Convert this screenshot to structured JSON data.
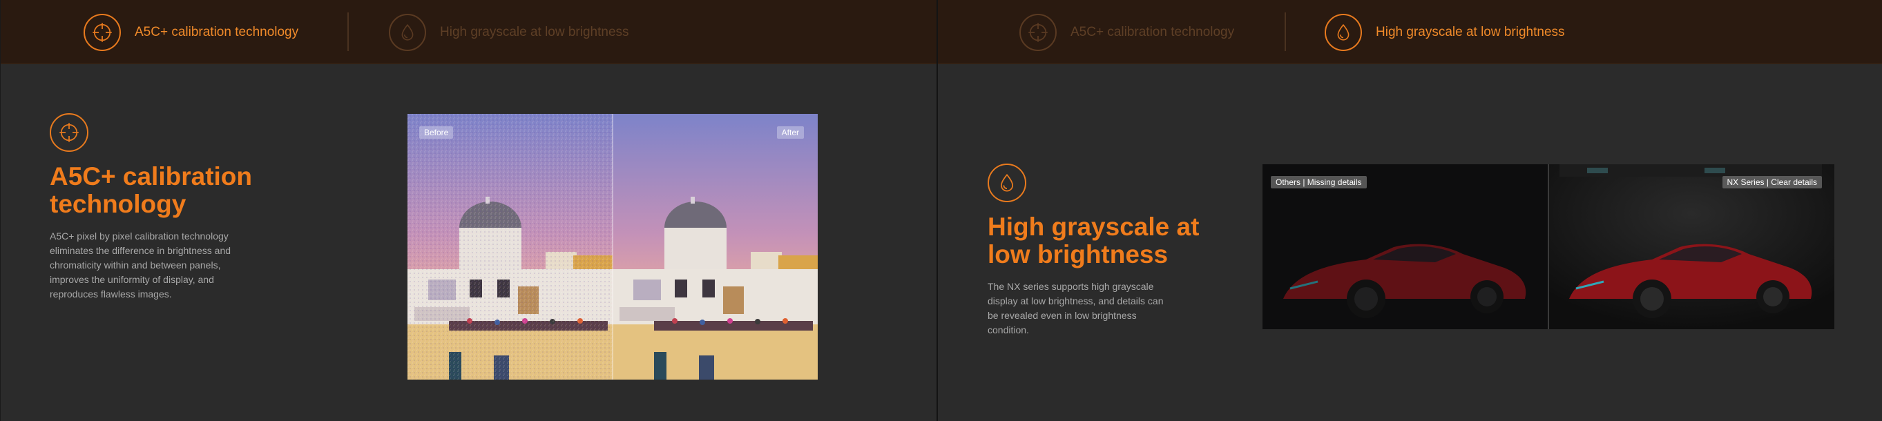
{
  "panels": [
    {
      "tabs": [
        {
          "label": "A5C+ calibration technology",
          "icon": "crosshair-icon",
          "state": "active"
        },
        {
          "label": "High grayscale at low brightness",
          "icon": "droplet-icon",
          "state": "inactive"
        }
      ],
      "feature": {
        "icon": "crosshair-icon",
        "title_line1": "A5C+ calibration",
        "title_line2": "technology",
        "description_lines": [
          "A5C+ pixel by pixel calibration technology",
          "eliminates the difference in brightness and",
          "chromaticity within and between panels,",
          "improves the uniformity of display, and",
          "reproduces flawless images."
        ]
      },
      "comparison": {
        "left_label": "Before",
        "right_label": "After"
      }
    },
    {
      "tabs": [
        {
          "label": "A5C+ calibration technology",
          "icon": "crosshair-icon",
          "state": "inactive"
        },
        {
          "label": "High grayscale at low brightness",
          "icon": "droplet-icon",
          "state": "active"
        }
      ],
      "feature": {
        "icon": "droplet-icon",
        "title_line1": "High grayscale at",
        "title_line2": "low brightness",
        "description_lines": [
          "The NX series supports high grayscale",
          "display at low brightness, and details can",
          "be revealed even in low brightness",
          "condition."
        ]
      },
      "comparison": {
        "left_label": "Others | Missing details",
        "right_label": "NX Series | Clear details"
      }
    }
  ],
  "colors": {
    "accent": "#f07c1c",
    "tab_bar": "#2a1a10",
    "background": "#2b2b2b",
    "text_muted": "#a8a8a8"
  }
}
